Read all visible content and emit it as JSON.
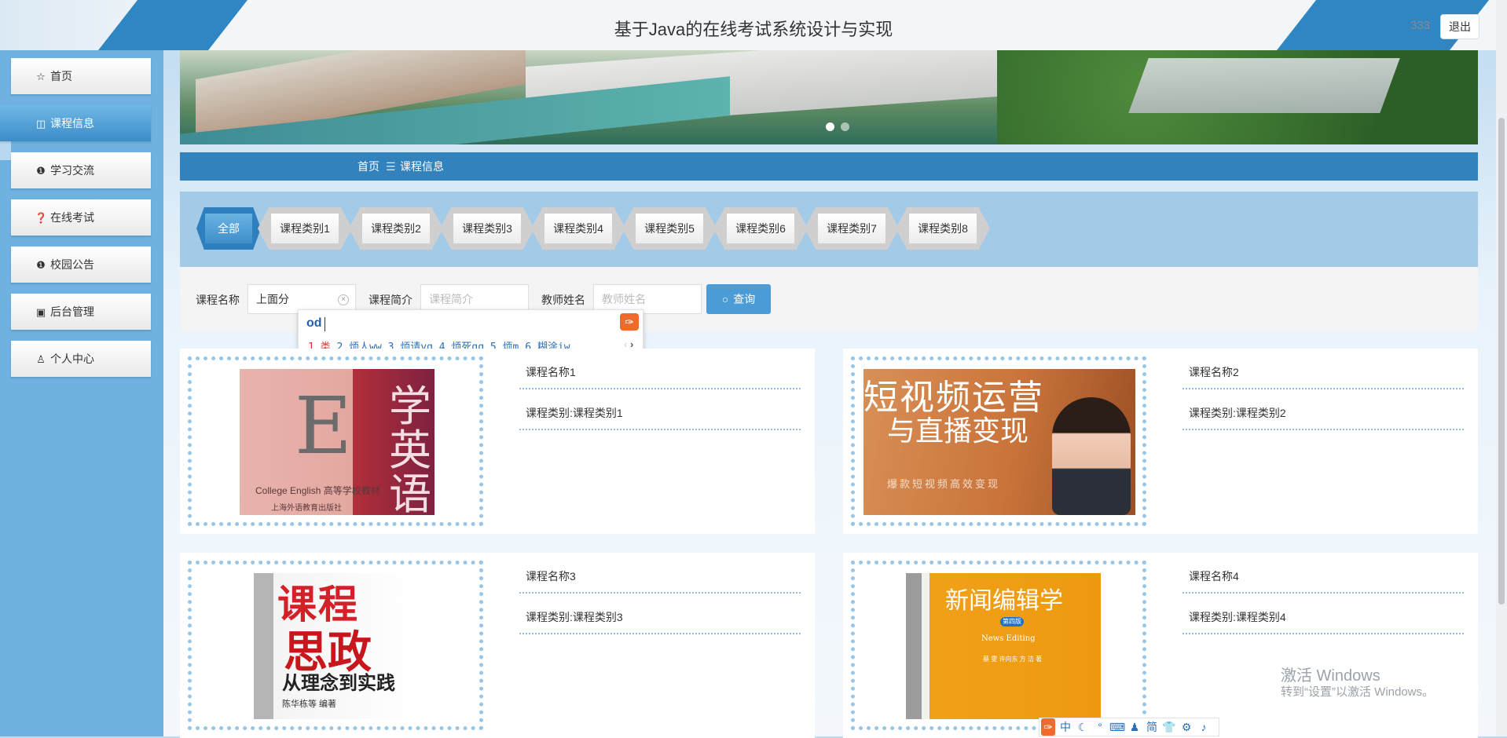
{
  "header": {
    "title": "基于Java的在线考试系统设计与实现",
    "user": "333",
    "logout": "退出"
  },
  "sidebar": {
    "items": [
      {
        "label": "首页",
        "icon": "star-icon",
        "glyph": "☆"
      },
      {
        "label": "课程信息",
        "icon": "bag-icon",
        "glyph": "◫",
        "active": true
      },
      {
        "label": "学习交流",
        "icon": "info-circle-icon",
        "glyph": "❶"
      },
      {
        "label": "在线考试",
        "icon": "question-circle-icon",
        "glyph": "❓"
      },
      {
        "label": "校园公告",
        "icon": "info-icon",
        "glyph": "❶"
      },
      {
        "label": "后台管理",
        "icon": "briefcase-icon",
        "glyph": "▣"
      },
      {
        "label": "个人中心",
        "icon": "user-icon",
        "glyph": "♙"
      }
    ]
  },
  "breadcrumb": {
    "home": "首页",
    "separator": "☰",
    "current": "课程信息"
  },
  "categories": [
    "全部",
    "课程类别1",
    "课程类别2",
    "课程类别3",
    "课程类别4",
    "课程类别5",
    "课程类别6",
    "课程类别7",
    "课程类别8"
  ],
  "search": {
    "name_label": "课程名称",
    "name_value": "上面分",
    "intro_label": "课程简介",
    "intro_placeholder": "课程简介",
    "teacher_label": "教师姓名",
    "teacher_placeholder": "教师姓名",
    "button": "查询"
  },
  "ime": {
    "composition": "od",
    "candidates": [
      "1.类",
      "2.烦人ww",
      "3.烦请yg",
      "4.烦死gq",
      "5.烦m",
      "6.糊涂iw"
    ],
    "prev": "‹",
    "next": "›",
    "logo": "✑"
  },
  "courses": [
    {
      "name": "课程名称1",
      "category": "课程类别:课程类别1",
      "cover": {
        "big": "E",
        "cn": "学英语",
        "sub": "College English 高等学校教材",
        "pub": "上海外语教育出版社"
      }
    },
    {
      "name": "课程名称2",
      "category": "课程类别:课程类别2",
      "cover": {
        "h1": "短视频运营",
        "h2": "与直播变现",
        "h3": "爆款短视频高效变现"
      }
    },
    {
      "name": "课程名称3",
      "category": "课程类别:课程类别3",
      "cover": {
        "a": "课程",
        "b": "思政",
        "c": "从理念到实践",
        "d": "陈华栋等  编著"
      }
    },
    {
      "name": "课程名称4",
      "category": "课程类别:课程类别4",
      "cover": {
        "a": "新闻编辑学",
        "b": "第四版",
        "c": "News Editing",
        "d": "蔡 雯  许向东  方 洁 著"
      }
    }
  ],
  "watermark": {
    "line1": "激活 Windows",
    "line2": "转到“设置”以激活 Windows。"
  },
  "tray": [
    "✑",
    "中",
    "☾",
    "°",
    "⌨",
    "♟",
    "简",
    "👕",
    "⚙",
    "♪"
  ],
  "colors": {
    "primary": "#3282be",
    "sidebar": "#6fb1e0",
    "active_tab": "#3f8fca"
  }
}
